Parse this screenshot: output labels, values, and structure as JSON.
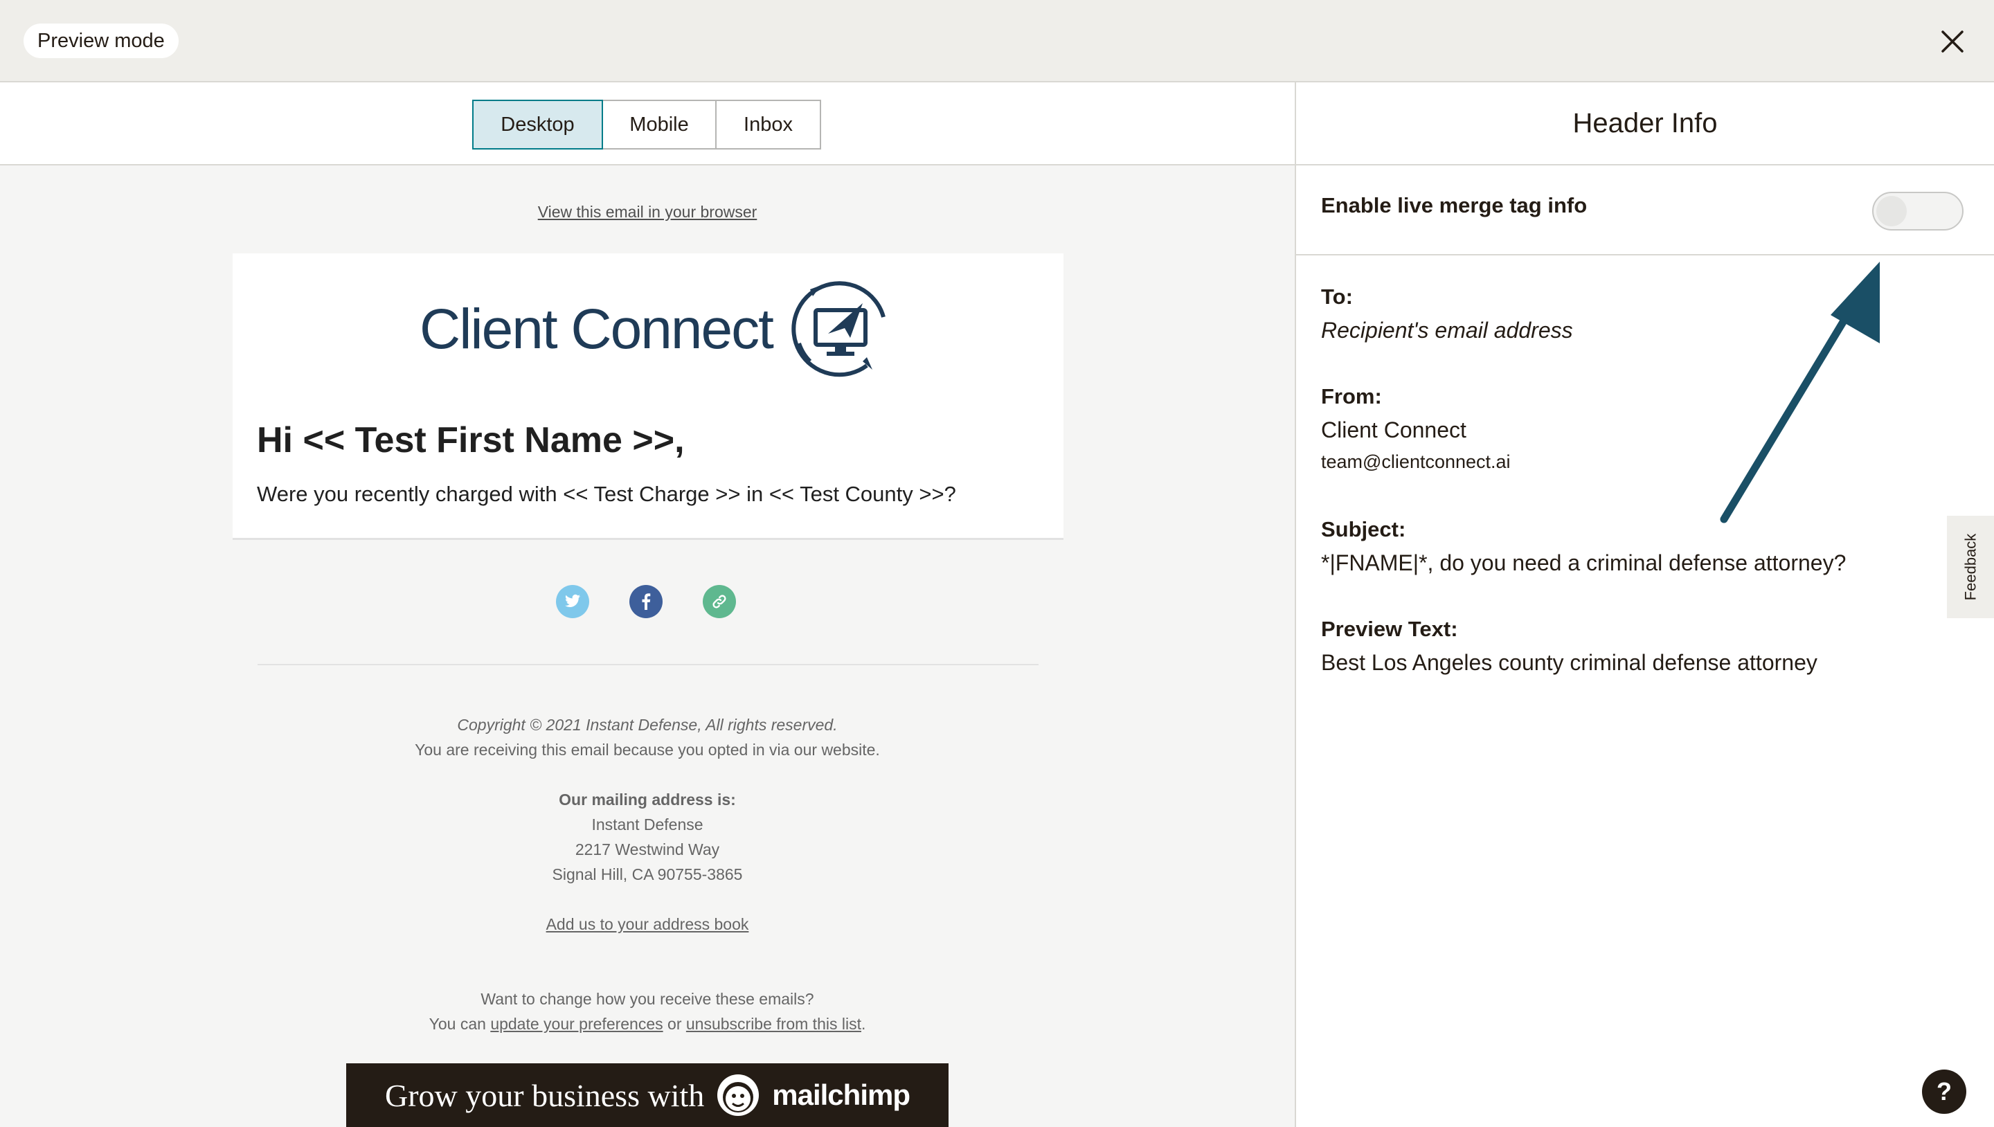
{
  "topbar": {
    "mode_label": "Preview mode"
  },
  "tabs": [
    {
      "label": "Desktop",
      "active": true
    },
    {
      "label": "Mobile",
      "active": false
    },
    {
      "label": "Inbox",
      "active": false
    }
  ],
  "email": {
    "view_in_browser": "View this email in your browser",
    "logo_text": "Client Connect",
    "greeting": "Hi << Test First Name >>,",
    "question": "Were you recently charged with << Test Charge >> in << Test County >>?",
    "social_icons": [
      "twitter-icon",
      "facebook-icon",
      "link-icon"
    ],
    "footer": {
      "copyright": "Copyright © 2021 Instant Defense, All rights reserved.",
      "reason": "You are receiving this email because you opted in via our website.",
      "mailing_heading": "Our mailing address is:",
      "address_name": "Instant Defense",
      "address_street": "2217 Westwind Way",
      "address_city": "Signal Hill, CA 90755-3865",
      "add_address_book": "Add us to your address book",
      "change_prompt": "Want to change how you receive these emails?",
      "you_can": "You can",
      "update_prefs": "update your preferences",
      "or": "or",
      "unsubscribe": "unsubscribe from this list",
      "period": "."
    },
    "banner": {
      "text": "Grow your business with",
      "brand": "mailchimp"
    }
  },
  "header_info": {
    "title": "Header Info",
    "toggle_label": "Enable live merge tag info",
    "toggle_on": false,
    "to_label": "To:",
    "to_value": "Recipient's email address",
    "from_label": "From:",
    "from_name": "Client Connect",
    "from_email": "team@clientconnect.ai",
    "subject_label": "Subject:",
    "subject_value": "*|FNAME|*, do you need a criminal defense attorney?",
    "preview_label": "Preview Text:",
    "preview_value": "Best Los Angeles county criminal defense attorney"
  },
  "feedback_label": "Feedback",
  "help_label": "?",
  "colors": {
    "accent": "#007c89",
    "active_tab_bg": "#d7e9ee",
    "arrow": "#1a4f66",
    "twitter": "#7fc8eb",
    "facebook": "#3e5f9b",
    "link": "#5fb88f"
  }
}
